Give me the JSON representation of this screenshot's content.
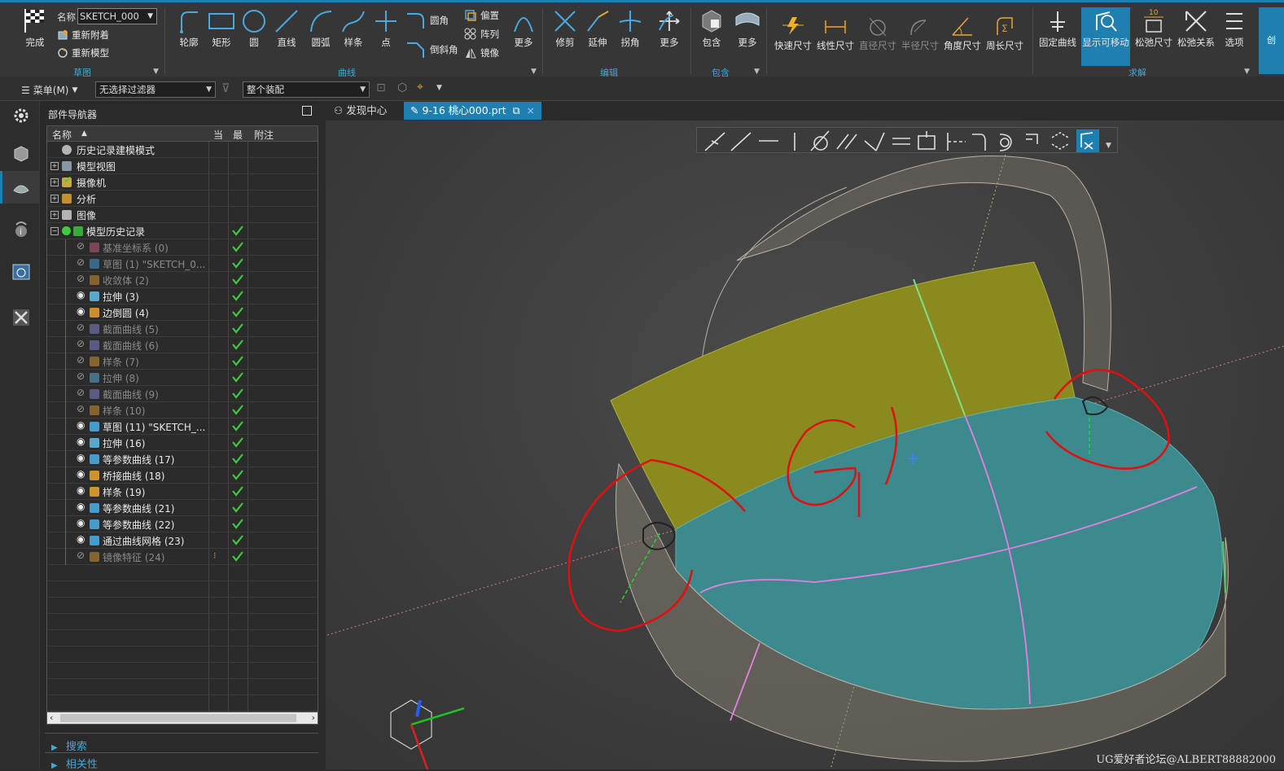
{
  "ribbon": {
    "sketch_group": {
      "finish_label": "完成",
      "name_label": "名称",
      "name_value": "SKETCH_000",
      "reattach_label": "重新附着",
      "remodel_label": "重新模型",
      "group_label": "草图"
    },
    "curve_group": {
      "buttons": [
        "轮廓",
        "矩形",
        "圆",
        "直线",
        "圆弧",
        "样条",
        "点"
      ],
      "fillet_label": "圆角",
      "chamfer_label": "倒斜角",
      "offset_label": "偏置",
      "array_label": "阵列",
      "mirror_label": "镜像",
      "more_label": "更多",
      "group_label": "曲线"
    },
    "edit_group": {
      "buttons": [
        "修剪",
        "延伸",
        "拐角",
        "更多"
      ],
      "group_label": "编辑"
    },
    "include_group": {
      "buttons": [
        "包含",
        "更多"
      ],
      "group_label": "包含"
    },
    "dim_group": {
      "buttons": [
        "快速尺寸",
        "线性尺寸",
        "直径尺寸",
        "半径尺寸",
        "角度尺寸",
        "周长尺寸"
      ]
    },
    "solve_group": {
      "buttons": [
        "固定曲线",
        "显示可移动",
        "松弛尺寸",
        "松弛关系",
        "选项"
      ],
      "group_label": "求解"
    },
    "overflow_label": "创"
  },
  "toolbar2": {
    "menu_label": "菜单(M)",
    "filter_value": "无选择过滤器",
    "assembly_value": "整个装配"
  },
  "navigator": {
    "title": "部件导航器",
    "columns": [
      "名称",
      "当",
      "最",
      "附注"
    ],
    "rows": [
      {
        "label": "历史记录建模模式",
        "gray": false,
        "check": false
      },
      {
        "label": "模型视图",
        "gray": false,
        "check": false
      },
      {
        "label": "摄像机",
        "gray": false,
        "check": false
      },
      {
        "label": "分析",
        "gray": false,
        "check": false
      },
      {
        "label": "图像",
        "gray": false,
        "check": false
      },
      {
        "label": "模型历史记录",
        "gray": false,
        "check": true
      },
      {
        "label": "基准坐标系 (0)",
        "gray": true,
        "check": true
      },
      {
        "label": "草图 (1) \"SKETCH_0...",
        "gray": true,
        "check": true
      },
      {
        "label": "收敛体 (2)",
        "gray": true,
        "check": true
      },
      {
        "label": "拉伸 (3)",
        "gray": false,
        "check": true
      },
      {
        "label": "边倒圆 (4)",
        "gray": false,
        "check": true
      },
      {
        "label": "截面曲线 (5)",
        "gray": true,
        "check": true
      },
      {
        "label": "截面曲线 (6)",
        "gray": true,
        "check": true
      },
      {
        "label": "样条 (7)",
        "gray": true,
        "check": true
      },
      {
        "label": "拉伸 (8)",
        "gray": true,
        "check": true
      },
      {
        "label": "截面曲线 (9)",
        "gray": true,
        "check": true
      },
      {
        "label": "样条 (10)",
        "gray": true,
        "check": true
      },
      {
        "label": "草图 (11) \"SKETCH_...",
        "gray": false,
        "check": true
      },
      {
        "label": "拉伸 (16)",
        "gray": false,
        "check": true
      },
      {
        "label": "等参数曲线 (17)",
        "gray": false,
        "check": true
      },
      {
        "label": "桥接曲线 (18)",
        "gray": false,
        "check": true
      },
      {
        "label": "样条 (19)",
        "gray": false,
        "check": true
      },
      {
        "label": "等参数曲线 (21)",
        "gray": false,
        "check": true
      },
      {
        "label": "等参数曲线 (22)",
        "gray": false,
        "check": true
      },
      {
        "label": "通过曲线网格 (23)",
        "gray": false,
        "check": true
      },
      {
        "label": "镜像特征 (24)",
        "gray": true,
        "check": true
      }
    ],
    "search_label": "搜索",
    "related_label": "相关性"
  },
  "tabs": [
    {
      "label": "发现中心",
      "active": false
    },
    {
      "label": "9-16 桃心000.prt",
      "active": true
    }
  ],
  "watermark": "UG爱好者论坛@ALBERT88882000",
  "colors": {
    "accent": "#1e7fb0",
    "surface_yellow": "#8a8a1e",
    "surface_teal": "#3d8a8e",
    "annotation_red": "#e01010",
    "check_green": "#3ccd3c"
  }
}
